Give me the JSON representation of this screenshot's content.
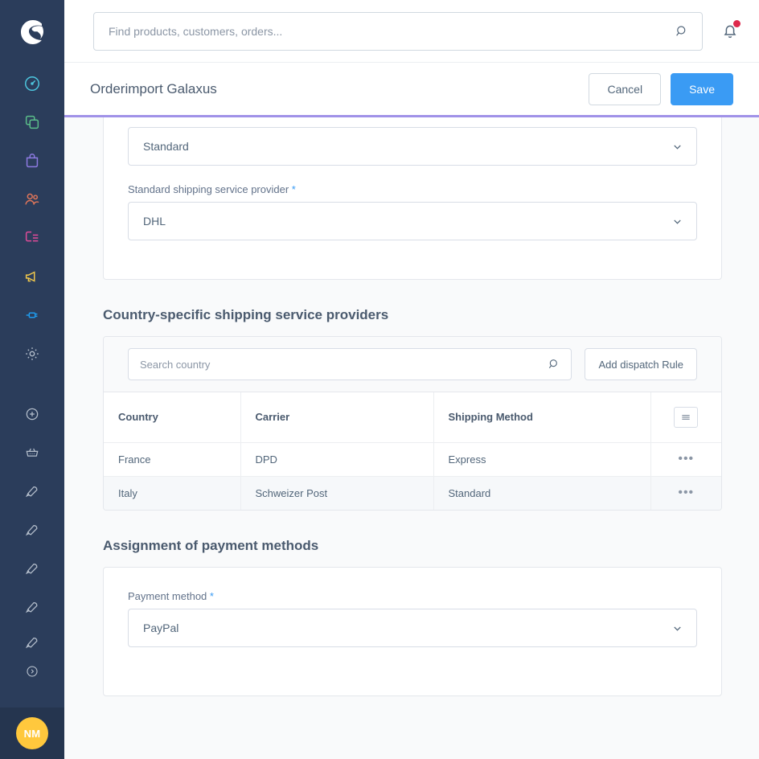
{
  "sidebar": {
    "logo": "shopware-logo",
    "items": [
      {
        "name": "sidebar-item-dashboard",
        "icon": "dashboard-gauge-icon",
        "color": "#4dc8e0"
      },
      {
        "name": "sidebar-item-catalogues",
        "icon": "copy-layers-icon",
        "color": "#5bbf8a"
      },
      {
        "name": "sidebar-item-orders",
        "icon": "shopping-bag-icon",
        "color": "#8e7be3"
      },
      {
        "name": "sidebar-item-customers",
        "icon": "users-icon",
        "color": "#e0765a"
      },
      {
        "name": "sidebar-item-content",
        "icon": "content-list-icon",
        "color": "#e14b9a"
      },
      {
        "name": "sidebar-item-marketing",
        "icon": "megaphone-icon",
        "color": "#f2c94c"
      },
      {
        "name": "sidebar-item-extensions",
        "icon": "plug-icon",
        "color": "#1f9bed"
      },
      {
        "name": "sidebar-item-settings",
        "icon": "gear-icon",
        "color": "#b5bfcc"
      }
    ],
    "favorites": [
      {
        "name": "sidebar-item-add",
        "icon": "plus-circle-icon",
        "color": "#b5bfcc"
      },
      {
        "name": "sidebar-item-basket",
        "icon": "basket-icon",
        "color": "#b5bfcc"
      },
      {
        "name": "sidebar-item-rocket-1",
        "icon": "rocket-icon",
        "color": "#b5bfcc"
      },
      {
        "name": "sidebar-item-rocket-2",
        "icon": "rocket-icon",
        "color": "#b5bfcc"
      },
      {
        "name": "sidebar-item-rocket-3",
        "icon": "rocket-icon",
        "color": "#b5bfcc"
      },
      {
        "name": "sidebar-item-rocket-4",
        "icon": "rocket-icon",
        "color": "#b5bfcc"
      },
      {
        "name": "sidebar-item-rocket-5",
        "icon": "rocket-icon",
        "color": "#b5bfcc"
      },
      {
        "name": "sidebar-item-expand",
        "icon": "chevron-right-circle-icon",
        "color": "#b5bfcc"
      }
    ],
    "avatar_initials": "NM",
    "avatar_color": "#ffc83d"
  },
  "topbar": {
    "search_placeholder": "Find products, customers, orders...",
    "search_value": "",
    "search_icon": "search-icon",
    "notification_icon": "bell-icon",
    "notification_dot_color": "#de294c"
  },
  "smartbar": {
    "title": "Orderimport Galaxus",
    "cancel_label": "Cancel",
    "save_label": "Save",
    "accent_color": "#a092e8",
    "save_color": "#3a9bf4"
  },
  "shipping_card": {
    "method_value": "Standard",
    "provider_label": "Standard shipping service provider",
    "provider_required": "*",
    "provider_value": "DHL"
  },
  "country_section": {
    "title": "Country-specific shipping service providers",
    "search_placeholder": "Search country",
    "search_value": "",
    "add_rule_label": "Add dispatch Rule",
    "columns": [
      "Country",
      "Carrier",
      "Shipping Method"
    ],
    "rows": [
      {
        "country": "France",
        "carrier": "DPD",
        "method": "Express"
      },
      {
        "country": "Italy",
        "carrier": "Schweizer Post",
        "method": "Standard"
      }
    ],
    "row_action_glyph": "•••",
    "header_menu_icon": "hamburger-icon"
  },
  "payment_section": {
    "title": "Assignment of payment methods",
    "label": "Payment method",
    "required": "*",
    "value": "PayPal"
  }
}
